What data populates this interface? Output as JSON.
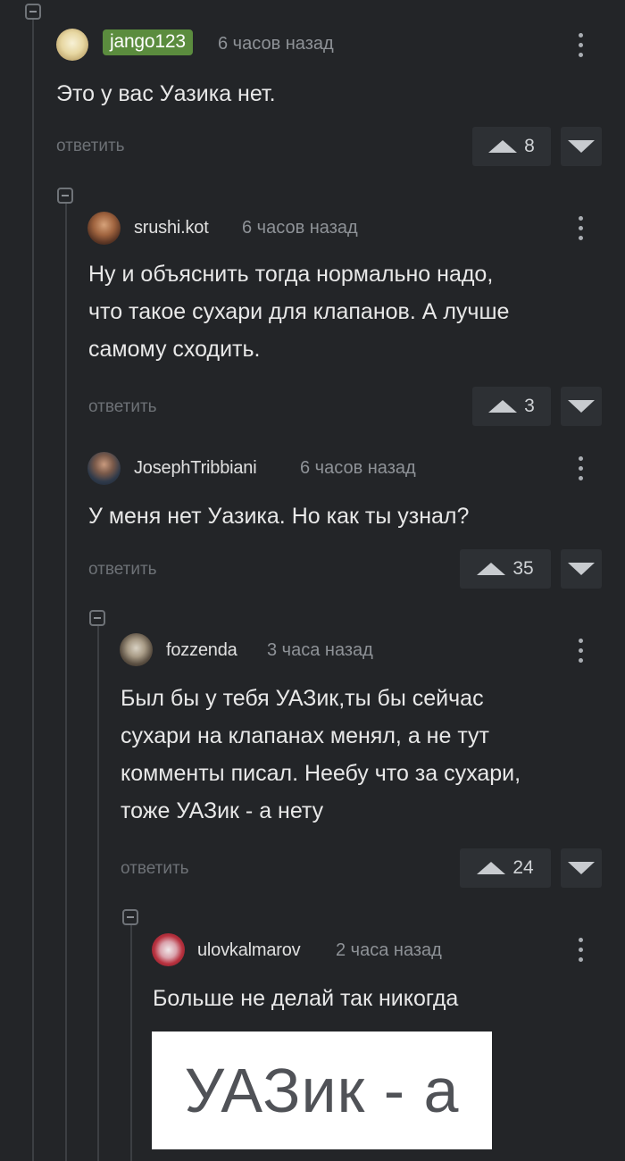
{
  "comments": [
    {
      "username": "jango123",
      "time": "6 часов назад",
      "text": "Это у вас Уазика нет.",
      "reply_label": "ответить",
      "votes": "8"
    },
    {
      "username": "srushi.kot",
      "time": "6 часов назад",
      "text": "Ну и объяснить тогда нормально надо,\nчто такое сухари для клапанов. А лучше\nсамому сходить.",
      "reply_label": "ответить",
      "votes": "3"
    },
    {
      "username": "JosephTribbiani",
      "time": "6 часов назад",
      "text": "У меня нет Уазика.  Но как ты узнал?",
      "reply_label": "ответить",
      "votes": "35"
    },
    {
      "username": "fozzenda",
      "time": "3 часа назад",
      "text": "Был бы у тебя УАЗик,ты бы сейчас\nсухари на клапанах менял, а не тут\nкомменты писал. Неебу что за сухари,\nтоже УАЗик - а нету",
      "reply_label": "ответить",
      "votes": "24"
    },
    {
      "username": "ulovkalmarov",
      "time": "2 часа назад",
      "text": "Больше не делай так никогда",
      "image_text": "УАЗик - а"
    }
  ],
  "icons": {
    "collapse": "minus-square-icon",
    "more": "vertical-dots-icon",
    "upvote": "triangle-up-icon",
    "downvote": "triangle-down-icon"
  },
  "colors": {
    "background": "#232528",
    "badge": "#5b8c3e",
    "vote_bg": "#2d3034"
  }
}
